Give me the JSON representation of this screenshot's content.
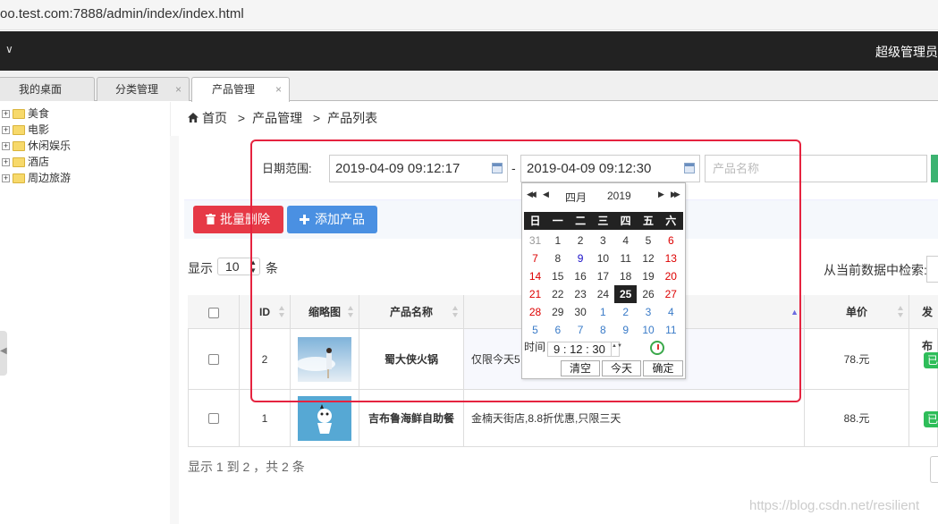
{
  "browser": {
    "url": "oo.test.com:7888/admin/index/index.html"
  },
  "header": {
    "chevron": "∨",
    "user": "超级管理员"
  },
  "tabs": [
    {
      "label": "我的桌面"
    },
    {
      "label": "分类管理",
      "close": "×"
    },
    {
      "label": "产品管理",
      "close": "×"
    }
  ],
  "tree": {
    "expander": "+",
    "items": [
      {
        "label": "美食"
      },
      {
        "label": "电影"
      },
      {
        "label": "休闲娱乐"
      },
      {
        "label": "酒店"
      },
      {
        "label": "周边旅游"
      }
    ]
  },
  "breadcrumb": {
    "home": "首页",
    "sep": ">",
    "section": "产品管理",
    "page": "产品列表"
  },
  "search": {
    "date_label": "日期范围:",
    "start": "2019-04-09 09:12:17",
    "dash": "-",
    "end": "2019-04-09 09:12:30",
    "name_placeholder": "产品名称"
  },
  "toolbar": {
    "delete_label": "批量删除",
    "add_label": "添加产品",
    "delete_icon": "trash-icon",
    "add_icon": "plus-icon"
  },
  "length": {
    "prefix": "显示",
    "value": "10",
    "suffix": "条"
  },
  "filter": {
    "label": "从当前数据中检索:"
  },
  "table": {
    "headers": {
      "id": "ID",
      "thumb": "缩略图",
      "name": "产品名称",
      "price": "单价",
      "publish": "发布"
    },
    "rows": [
      {
        "id": "2",
        "name": "蜀大侠火锅",
        "desc": "仅限今天5",
        "price": "78.元",
        "status": "已"
      },
      {
        "id": "1",
        "name": "吉布鲁海鲜自助餐",
        "desc": "金楠天街店,8.8折优惠,只限三天",
        "price": "88.元",
        "status": "已"
      }
    ]
  },
  "info": "显示 1 到 2 ，共 2 条",
  "watermark": "https://blog.csdn.net/resilient",
  "datepicker": {
    "prev_year": "◀◀",
    "prev_month": "◀",
    "month": "四月",
    "year": "2019",
    "next_month": "▶",
    "next_year": "▶▶",
    "weekdays": [
      "日",
      "一",
      "二",
      "三",
      "四",
      "五",
      "六"
    ],
    "days": [
      [
        "31",
        "1",
        "2",
        "3",
        "4",
        "5",
        "6"
      ],
      [
        "7",
        "8",
        "9",
        "10",
        "11",
        "12",
        "13"
      ],
      [
        "14",
        "15",
        "16",
        "17",
        "18",
        "19",
        "20"
      ],
      [
        "21",
        "22",
        "23",
        "24",
        "25",
        "26",
        "27"
      ],
      [
        "28",
        "29",
        "30",
        "1",
        "2",
        "3",
        "4"
      ],
      [
        "5",
        "6",
        "7",
        "8",
        "9",
        "10",
        "11"
      ]
    ],
    "selected": "25",
    "time_label": "时间",
    "time_value": "9 : 12 : 30",
    "spin": "▲▼",
    "clear": "清空",
    "today": "今天",
    "ok": "确定"
  },
  "colors": {
    "delete": "#e63946",
    "add": "#4a90e2",
    "highlight_box": "#e5233f",
    "badge": "#2ebd59"
  }
}
